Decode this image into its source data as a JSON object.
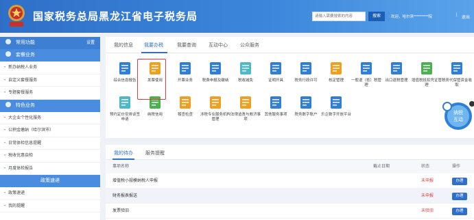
{
  "header": {
    "title": "国家税务总局黑龙江省电子税务局",
    "search_placeholder": "请输入需要搜索的内容",
    "search_label": "搜索",
    "welcome": "欢迎，哈尔滨**********院",
    "separator": "|",
    "logout": "退出"
  },
  "sidebar": {
    "common": {
      "label": "常用功能",
      "setting": "设置"
    },
    "tax": {
      "label": "套餐业务"
    },
    "tax_items": [
      "新办纳税人业务",
      "自定义套餐服务",
      "专题套餐服务"
    ],
    "special": {
      "label": "特色业务"
    },
    "special_items": [
      "大企业个性化服务",
      "公积金缴纳（哈尔滨市）",
      "日常体检信息提醒",
      "税收优惠自检",
      "月度体检报告"
    ],
    "policy": {
      "label": "政策速递"
    },
    "policy_items": [
      "政策速递",
      "我的提醒"
    ]
  },
  "main": {
    "tabs": [
      "我的信息",
      "我要办税",
      "我要查询",
      "互动中心",
      "公众服务"
    ],
    "active_tab": 1,
    "apps_row1": [
      {
        "label": "综合信息报告",
        "icon": "report-icon",
        "color": "#2f7fd6"
      },
      {
        "label": "发票使用",
        "icon": "invoice-icon",
        "color": "#f0a020"
      },
      {
        "label": "开票业务",
        "icon": "billing-icon",
        "color": "#2f7fd6"
      },
      {
        "label": "税费申报及缴纳",
        "icon": "declare-icon",
        "color": "#2f7fd6"
      },
      {
        "label": "税收减免",
        "icon": "reduction-icon",
        "color": "#4db8c8"
      },
      {
        "label": "证明开具",
        "icon": "certificate-icon",
        "color": "#2f7fd6"
      },
      {
        "label": "税务行政许可",
        "icon": "permit-icon",
        "color": "#2f7fd6"
      },
      {
        "label": "核定管理",
        "icon": "verify-icon",
        "color": "#f0a020"
      },
      {
        "label": "一般退（抵）税管理",
        "icon": "refund-icon",
        "color": "#2f7fd6"
      },
      {
        "label": "出口退税管理",
        "icon": "export-icon",
        "color": "#2f7fd6"
      },
      {
        "label": "增值税抵扣凭证管理",
        "icon": "vat-icon",
        "color": "#4caf50"
      },
      {
        "label": "税务代保管资金收取",
        "icon": "custody-icon",
        "color": "#2f7fd6"
      }
    ],
    "apps_row2": [
      {
        "label": "预约定价安排谈签申请",
        "icon": "pricing-icon",
        "color": "#4db8c8"
      },
      {
        "label": "纳税信用",
        "icon": "credit-icon",
        "color": "#4caf50"
      },
      {
        "label": "稽查检查",
        "icon": "inspect-icon",
        "color": "#f0a020"
      },
      {
        "label": "涉税专业服务机构管理",
        "icon": "agency-icon",
        "color": "#f0a020"
      },
      {
        "label": "法律追责与救济事项",
        "icon": "law-icon",
        "color": "#f0a020"
      },
      {
        "label": "其他服务事项",
        "icon": "other-icon",
        "color": "#2f7fd6"
      },
      {
        "label": "税务数字账户",
        "icon": "account-icon",
        "color": "#2f7fd6"
      },
      {
        "label": "乐企数字开放平台",
        "icon": "platform-icon",
        "color": "#2f7fd6"
      }
    ]
  },
  "todo": {
    "tabs": [
      "我的待办",
      "服务提醒"
    ],
    "columns": {
      "name": "事项名称",
      "date": "截止日期",
      "status": "状态",
      "op": "操作"
    },
    "rows": [
      {
        "name": "增值税小规模纳税人申报",
        "date": "",
        "status": "未申报",
        "op": "办理"
      },
      {
        "name": "财务报表报送",
        "date": "",
        "status": "未申报",
        "op": "办理"
      },
      {
        "name": "发票验旧",
        "date": "",
        "status": "未验旧",
        "op": "办理"
      }
    ]
  },
  "mascot": {
    "text": "纳税互动"
  }
}
